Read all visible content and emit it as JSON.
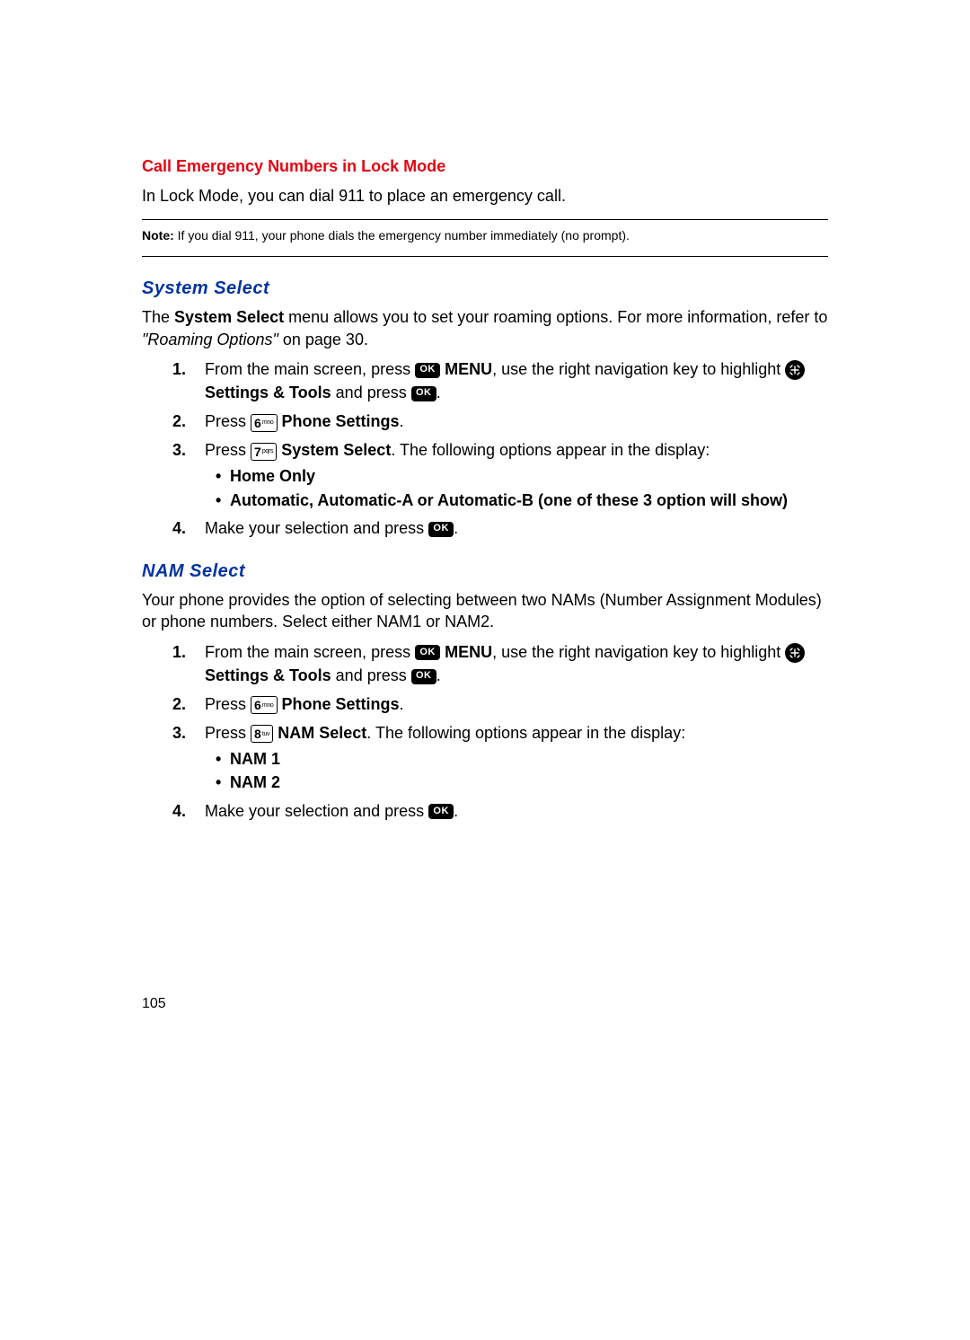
{
  "page_number": "105",
  "sec1": {
    "title": "Call Emergency Numbers in Lock Mode",
    "text": "In Lock Mode, you can dial 911 to place an emergency call.",
    "note_label": "Note:",
    "note_text": " If you dial 911, your phone dials the emergency number immediately (no prompt)."
  },
  "sec2": {
    "title": "System Select",
    "intro_a": "The ",
    "intro_b": "System Select",
    "intro_c": " menu allows you to set your roaming options. For more information, refer to ",
    "intro_ref": "\"Roaming Options\"",
    "intro_d": "  on page 30.",
    "s1_a": "From the main screen, press ",
    "s1_menu": " MENU",
    "s1_b": ", use the right navigation key to highlight ",
    "s1_st": " Settings & Tools",
    "s1_c": " and press ",
    "s1_end": ".",
    "s2_a": "Press ",
    "s2_ps": " Phone Settings",
    "s2_end": ".",
    "s3_a": "Press ",
    "s3_ss": " System Select",
    "s3_b": ". The following options appear in the display:",
    "b1": "Home Only",
    "b2": "Automatic, Automatic-A or Automatic-B (one of these 3 option will show)",
    "s4_a": "Make your selection and press ",
    "s4_end": "."
  },
  "sec3": {
    "title": "NAM Select",
    "intro": "Your phone provides the option of selecting between two NAMs (Number Assignment Modules) or phone numbers. Select either NAM1 or NAM2.",
    "s1_a": "From the main screen, press ",
    "s1_menu": " MENU",
    "s1_b": ", use the right navigation key to highlight ",
    "s1_st": " Settings & Tools",
    "s1_c": " and press ",
    "s1_end": ".",
    "s2_a": "Press ",
    "s2_ps": " Phone Settings",
    "s2_end": ".",
    "s3_a": "Press ",
    "s3_ns": " NAM Select",
    "s3_b": ". The following options appear in the display:",
    "b1": "NAM 1",
    "b2": "NAM 2",
    "s4_a": "Make your selection and press ",
    "s4_end": "."
  },
  "keys": {
    "ok": "OK",
    "six_big": "6",
    "six_sub": "mno",
    "seven_big": "7",
    "seven_sub": "pqrs",
    "eight_big": "8",
    "eight_sub": "tuv"
  },
  "nums": {
    "1": "1.",
    "2": "2.",
    "3": "3.",
    "4": "4."
  }
}
